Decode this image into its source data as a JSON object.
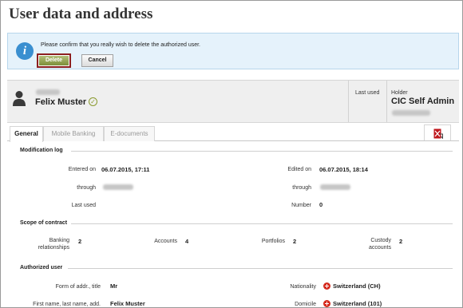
{
  "page": {
    "title": "User data and address"
  },
  "confirm": {
    "message": "Please confirm that you really wish to delete the authorized user.",
    "delete_label": "Delete",
    "cancel_label": "Cancel"
  },
  "user": {
    "name": "Felix Muster",
    "last_used_label": "Last used",
    "holder_label": "Holder",
    "holder_value": "CIC Self Admin"
  },
  "tabs": [
    {
      "label": "General",
      "active": true
    },
    {
      "label": "Mobile Banking",
      "active": false
    },
    {
      "label": "E-documents",
      "active": false
    }
  ],
  "modification_log": {
    "title": "Modification log",
    "entered_on_label": "Entered on",
    "entered_on_value": "06.07.2015, 17:11",
    "through_label_1": "through",
    "last_used_label": "Last used",
    "edited_on_label": "Edited on",
    "edited_on_value": "06.07.2015, 18:14",
    "through_label_2": "through",
    "number_label": "Number",
    "number_value": "0"
  },
  "scope": {
    "title": "Scope of contract",
    "banking_label_1": "Banking",
    "banking_label_2": "relationships",
    "banking_value": "2",
    "accounts_label": "Accounts",
    "accounts_value": "4",
    "portfolios_label": "Portfolios",
    "portfolios_value": "2",
    "custody_label_1": "Custody",
    "custody_label_2": "accounts",
    "custody_value": "2"
  },
  "authorized": {
    "title": "Authorized user",
    "form_label": "Form of addr., title",
    "form_value": "Mr",
    "names_label": "First name, last name, add.",
    "names_value": "Felix Muster",
    "nationality_label": "Nationality",
    "nationality_value": "Switzerland (CH)",
    "domicile_label": "Domicile",
    "domicile_value": "Switzerland (101)"
  },
  "icons": {
    "info": "info-icon",
    "user": "person-icon",
    "verified": "check-circle-icon",
    "pdf": "pdf-export-icon",
    "flag": "swiss-flag-icon"
  },
  "colors": {
    "confirm_bg": "#e5f2fb",
    "delete_border": "#8d1f1f",
    "delete_fill": "#7d8f3a",
    "verified": "#8a9a2e",
    "flag": "#d52b1e"
  }
}
